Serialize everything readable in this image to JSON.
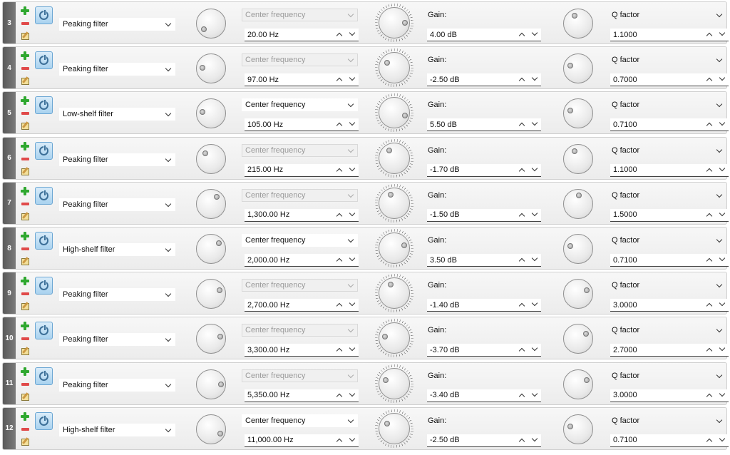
{
  "bands": [
    {
      "num": "3",
      "type": "Peaking filter",
      "freq_label": "Center frequency",
      "freq_enabled": false,
      "freq": "20.00 Hz",
      "gain_label": "Gain:",
      "gain": "4.00 dB",
      "q_label": "Q factor",
      "q": "1.1000",
      "knob_freq": 0.05,
      "knob_gain": 0.82,
      "knob_q": 0.4
    },
    {
      "num": "4",
      "type": "Peaking filter",
      "freq_label": "Center frequency",
      "freq_enabled": false,
      "freq": "97.00 Hz",
      "gain_label": "Gain:",
      "gain": "-2.50 dB",
      "q_label": "Q factor",
      "q": "0.7000",
      "knob_freq": 0.2,
      "knob_gain": 0.3,
      "knob_q": 0.25
    },
    {
      "num": "5",
      "type": "Low-shelf filter",
      "freq_label": "Center frequency",
      "freq_enabled": true,
      "freq": "105.00 Hz",
      "gain_label": "Gain:",
      "gain": "5.50 dB",
      "q_label": "Q factor",
      "q": "0.7100",
      "knob_freq": 0.22,
      "knob_gain": 0.88,
      "knob_q": 0.25
    },
    {
      "num": "6",
      "type": "Peaking filter",
      "freq_label": "Center frequency",
      "freq_enabled": false,
      "freq": "215.00 Hz",
      "gain_label": "Gain:",
      "gain": "-1.70 dB",
      "q_label": "Q factor",
      "q": "1.1000",
      "knob_freq": 0.33,
      "knob_gain": 0.38,
      "knob_q": 0.4
    },
    {
      "num": "7",
      "type": "Peaking filter",
      "freq_label": "Center frequency",
      "freq_enabled": false,
      "freq": "1,300.00 Hz",
      "gain_label": "Gain:",
      "gain": "-1.50 dB",
      "q_label": "Q factor",
      "q": "1.5000",
      "knob_freq": 0.62,
      "knob_gain": 0.4,
      "knob_q": 0.5
    },
    {
      "num": "8",
      "type": "High-shelf filter",
      "freq_label": "Center frequency",
      "freq_enabled": true,
      "freq": "2,000.00 Hz",
      "gain_label": "Gain:",
      "gain": "3.50 dB",
      "q_label": "Q factor",
      "q": "0.7100",
      "knob_freq": 0.68,
      "knob_gain": 0.75,
      "knob_q": 0.25
    },
    {
      "num": "9",
      "type": "Peaking filter",
      "freq_label": "Center frequency",
      "freq_enabled": false,
      "freq": "2,700.00 Hz",
      "gain_label": "Gain:",
      "gain": "-1.40 dB",
      "q_label": "Q factor",
      "q": "3.0000",
      "knob_freq": 0.72,
      "knob_gain": 0.41,
      "knob_q": 0.72
    },
    {
      "num": "10",
      "type": "Peaking filter",
      "freq_label": "Center frequency",
      "freq_enabled": false,
      "freq": "3,300.00 Hz",
      "gain_label": "Gain:",
      "gain": "-3.70 dB",
      "q_label": "Q factor",
      "q": "2.7000",
      "knob_freq": 0.76,
      "knob_gain": 0.22,
      "knob_q": 0.68
    },
    {
      "num": "11",
      "type": "Peaking filter",
      "freq_label": "Center frequency",
      "freq_enabled": false,
      "freq": "5,350.00 Hz",
      "gain_label": "Gain:",
      "gain": "-3.40 dB",
      "q_label": "Q factor",
      "q": "3.0000",
      "knob_freq": 0.82,
      "knob_gain": 0.25,
      "knob_q": 0.72
    },
    {
      "num": "12",
      "type": "High-shelf filter",
      "freq_label": "Center frequency",
      "freq_enabled": true,
      "freq": "11,000.00 Hz",
      "gain_label": "Gain:",
      "gain": "-2.50 dB",
      "q_label": "Q factor",
      "q": "0.7100",
      "knob_freq": 0.92,
      "knob_gain": 0.3,
      "knob_q": 0.25
    }
  ],
  "colors": {
    "row_bg": "#f0f0f0",
    "number_tab": "#666666",
    "add_icon": "#2fa82f",
    "remove_icon": "#e04a4a",
    "power_button": "#bfe0f5"
  },
  "icons": {
    "add": "plus-icon",
    "remove": "minus-icon",
    "edit": "edit-icon",
    "power": "power-icon",
    "dropdown": "chevron-down-icon",
    "spin_up": "chevron-up-icon"
  }
}
